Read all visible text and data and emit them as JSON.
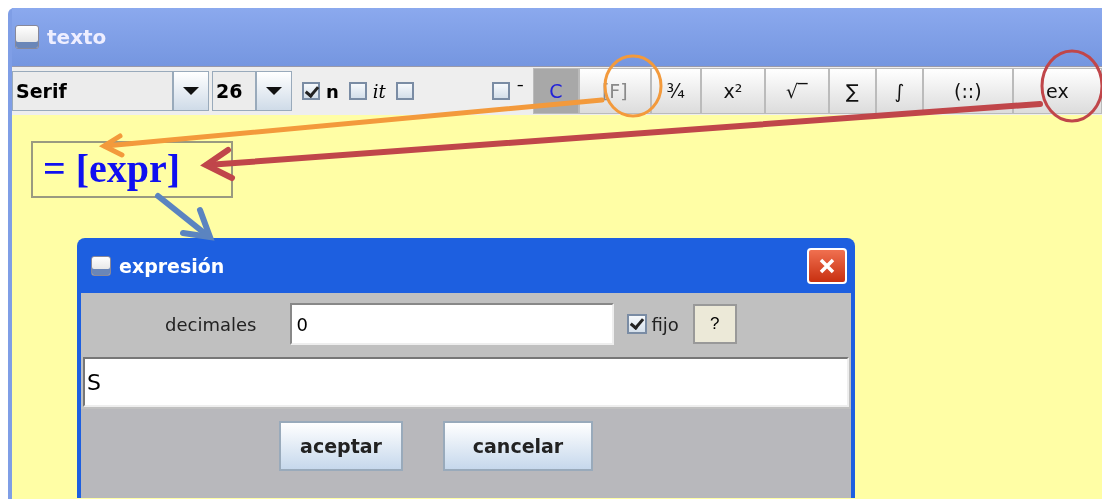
{
  "window": {
    "title": "texto"
  },
  "toolbar": {
    "font": "Serif",
    "size": "26",
    "checkboxes": [
      {
        "label": "n",
        "checked": true
      },
      {
        "label": "it",
        "checked": false
      },
      {
        "checked": false
      },
      {
        "label": "¯",
        "checked": false
      }
    ],
    "buttons": [
      {
        "label": "C",
        "selected": true,
        "disabled": false
      },
      {
        "label": "[F]",
        "selected": false,
        "disabled": true
      },
      {
        "label": "¾",
        "selected": false,
        "disabled": false
      },
      {
        "label": "x²",
        "selected": false,
        "disabled": false
      },
      {
        "label": "√‾",
        "selected": false,
        "disabled": false
      },
      {
        "label": "∑",
        "selected": false,
        "disabled": false
      },
      {
        "label": "∫",
        "selected": false,
        "disabled": false
      },
      {
        "label": "(::)",
        "selected": false,
        "disabled": false
      },
      {
        "label": "ex",
        "selected": false,
        "disabled": false
      }
    ]
  },
  "formula": "= [expr]",
  "dialog": {
    "title": "expresión",
    "decimals_label": "decimales",
    "decimals_value": "0",
    "fixed": {
      "label": "fijo",
      "checked": true
    },
    "help": "?",
    "expression": "S",
    "buttons": [
      "aceptar",
      "cancelar"
    ]
  }
}
